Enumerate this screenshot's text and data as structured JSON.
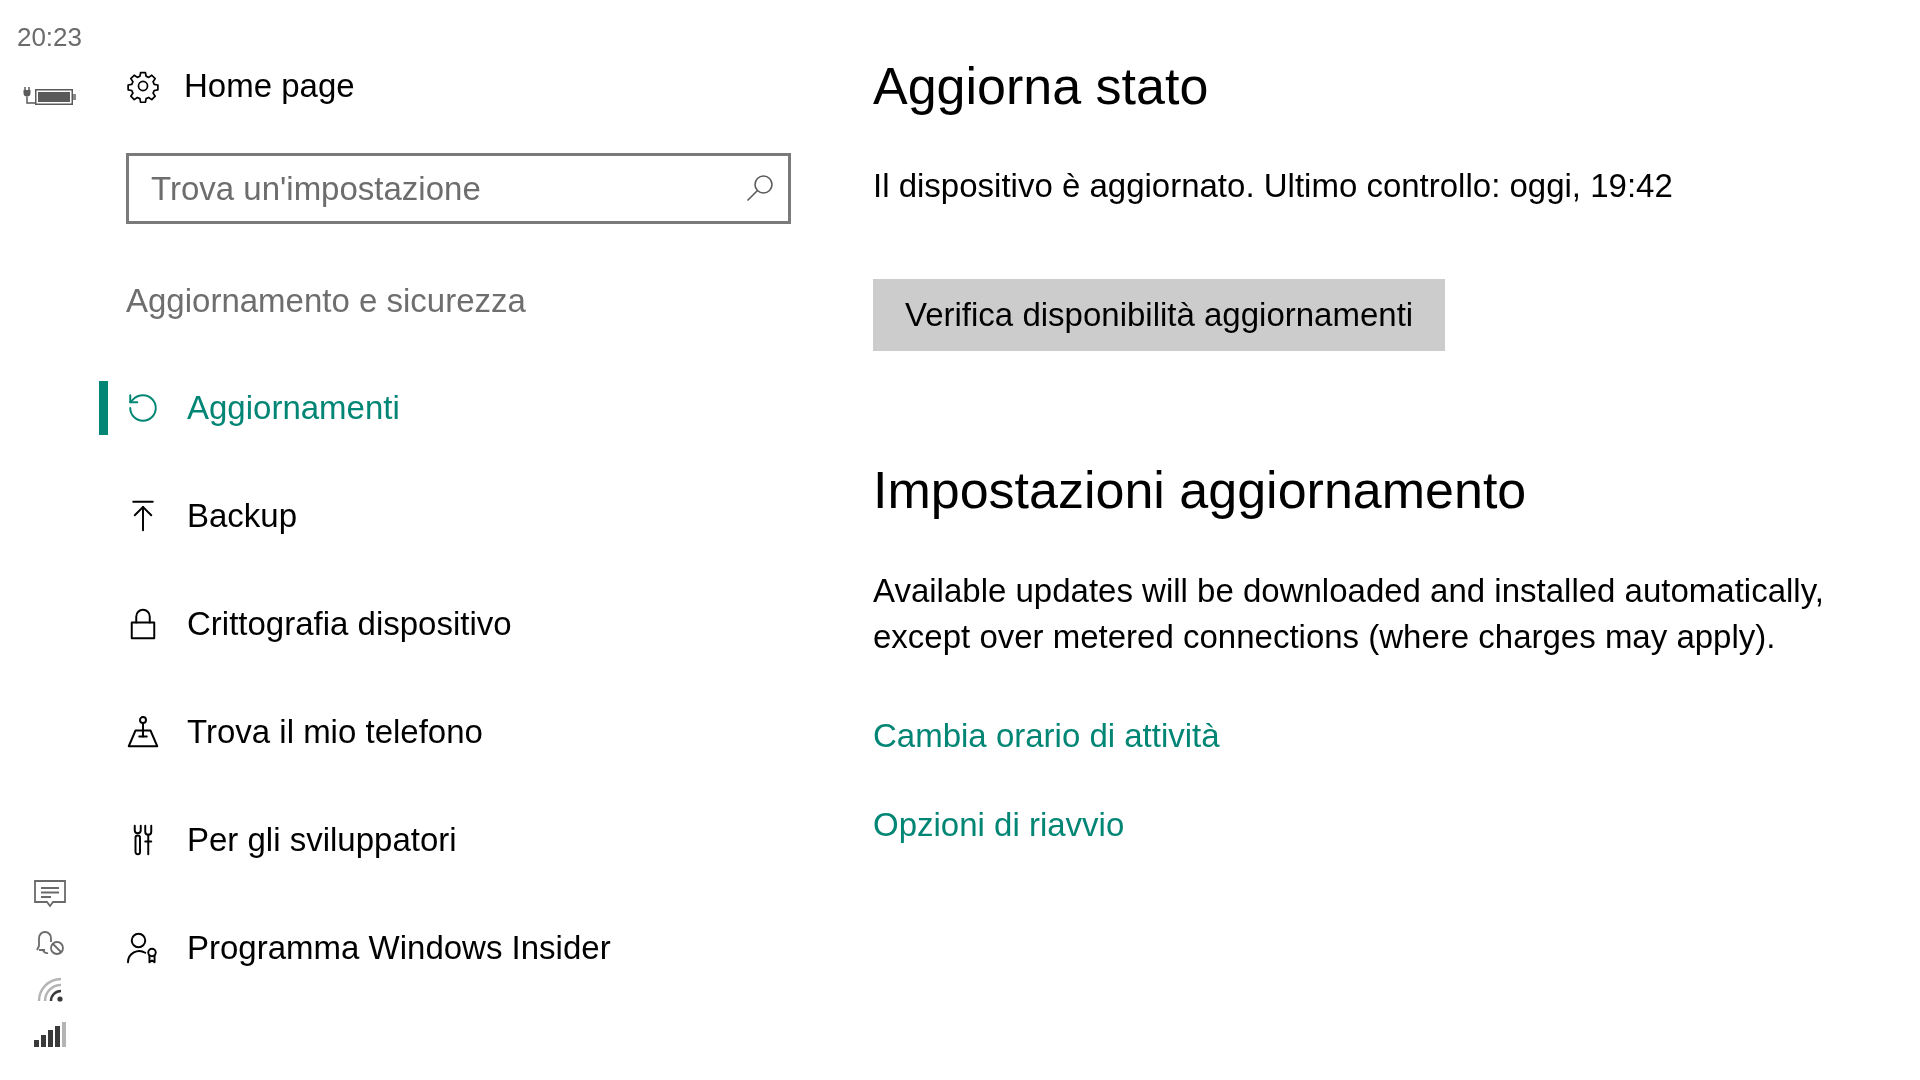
{
  "status_bar": {
    "time": "20:23"
  },
  "sidebar": {
    "home": "Home page",
    "search": {
      "placeholder": "Trova un'impostazione"
    },
    "section_title": "Aggiornamento e sicurezza",
    "items": [
      {
        "label": "Aggiornamenti",
        "selected": true
      },
      {
        "label": "Backup",
        "selected": false
      },
      {
        "label": "Crittografia dispositivo",
        "selected": false
      },
      {
        "label": "Trova il mio telefono",
        "selected": false
      },
      {
        "label": "Per gli sviluppatori",
        "selected": false
      },
      {
        "label": "Programma Windows Insider",
        "selected": false
      }
    ]
  },
  "update_status": {
    "title": "Aggiorna stato",
    "message": "Il dispositivo è aggiornato. Ultimo controllo: oggi, 19:42",
    "button": "Verifica disponibilità aggiornamenti"
  },
  "update_settings": {
    "title": "Impostazioni aggiornamento",
    "description": "Available updates will be downloaded and installed automatically, except over metered connections (where charges may apply).",
    "links": [
      "Cambia orario di attività",
      "Opzioni di riavvio"
    ]
  }
}
